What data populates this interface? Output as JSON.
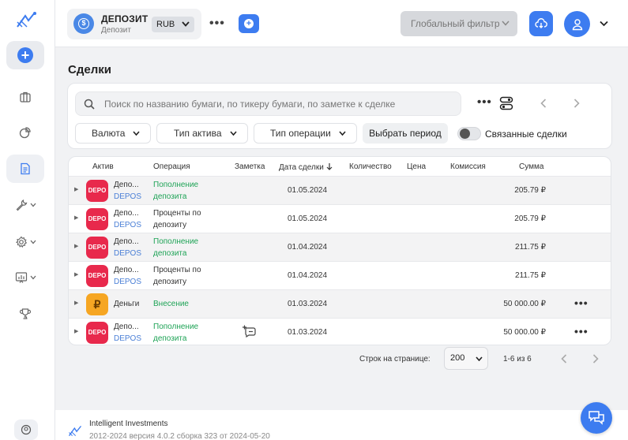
{
  "topbar": {
    "portfolio_name": "ДЕПОЗИТ",
    "portfolio_subtitle": "Депозит",
    "currency": "RUB",
    "global_filter": "Глобальный фильтр"
  },
  "page": {
    "title": "Сделки"
  },
  "filters": {
    "search_placeholder": "Поиск по названию бумаги, по тикеру бумаги, по заметке к сделке",
    "currency_dd": "Валюта",
    "asset_type_dd": "Тип актива",
    "operation_type_dd": "Тип операции",
    "period_button": "Выбрать период",
    "linked_deals_label": "Связанные сделки",
    "linked_deals_on": false
  },
  "table": {
    "headers": {
      "asset": "Актив",
      "operation": "Операция",
      "note": "Заметка",
      "date": "Дата сделки",
      "quantity": "Количество",
      "price": "Цена",
      "commission": "Комиссия",
      "sum": "Сумма"
    },
    "rows": [
      {
        "badge": "DEPO",
        "name": "Депо...",
        "ticker": "DEPOS",
        "op1": "Пополнение",
        "op2": "депозита",
        "op_color": "green",
        "date": "01.05.2024",
        "sum": "205.79 ₽"
      },
      {
        "badge": "DEPO",
        "name": "Депо...",
        "ticker": "DEPOS",
        "op1": "Проценты по",
        "op2": "депозиту",
        "op_color": "dark",
        "date": "01.05.2024",
        "sum": "205.79 ₽"
      },
      {
        "badge": "DEPO",
        "name": "Депо...",
        "ticker": "DEPOS",
        "op1": "Пополнение",
        "op2": "депозита",
        "op_color": "green",
        "date": "01.04.2024",
        "sum": "211.75 ₽"
      },
      {
        "badge": "DEPO",
        "name": "Депо...",
        "ticker": "DEPOS",
        "op1": "Проценты по",
        "op2": "депозиту",
        "op_color": "dark",
        "date": "01.04.2024",
        "sum": "211.75 ₽"
      },
      {
        "badge": "₽",
        "name": "Деньги",
        "ticker": "",
        "op1": "Внесение",
        "op2": "",
        "op_color": "green",
        "date": "01.03.2024",
        "sum": "50 000.00 ₽"
      },
      {
        "badge": "DEPO",
        "name": "Депо...",
        "ticker": "DEPOS",
        "op1": "Пополнение",
        "op2": "депозита",
        "op_color": "green",
        "date": "01.03.2024",
        "sum": "50 000.00 ₽"
      }
    ]
  },
  "pagination": {
    "rows_per_page_label": "Строк на странице:",
    "rows_per_page": "200",
    "range": "1-6 из 6"
  },
  "footer": {
    "app_name": "Intelligent Investments",
    "version": "2012-2024 версия 4.0.2 сборка 323 от 2024-05-20"
  },
  "colors": {
    "accent": "#3d7cf0",
    "depo_badge": "#e8294c",
    "money_badge": "#f6a623",
    "positive": "#1ea356",
    "ticker": "#4a7fd6"
  }
}
